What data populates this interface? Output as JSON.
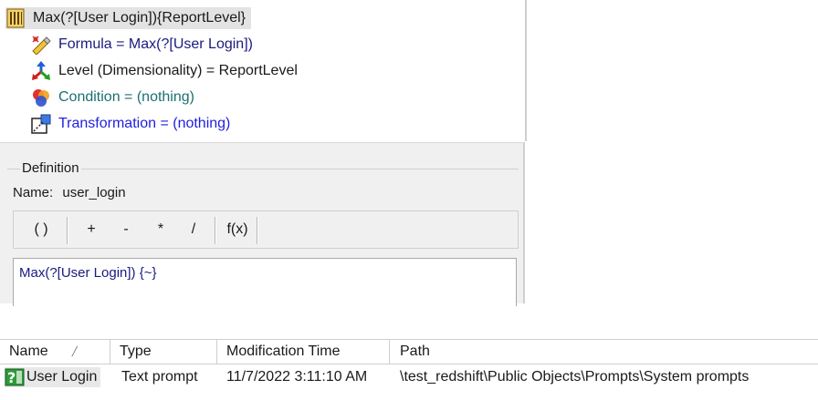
{
  "tree": {
    "root_label": "Max(?[User Login]){ReportLevel}",
    "items": [
      {
        "id": "formula",
        "label": "Formula = Max(?[User Login])",
        "icon": "formula-icon",
        "color": "#1a1a80"
      },
      {
        "id": "level",
        "label": "Level (Dimensionality) = ReportLevel",
        "icon": "level-icon",
        "color": "#1a1a1a"
      },
      {
        "id": "condition",
        "label": "Condition = (nothing)",
        "icon": "condition-icon",
        "color": "#1d6f73"
      },
      {
        "id": "transformation",
        "label": "Transformation = (nothing)",
        "icon": "transformation-icon",
        "color": "#1f1fe0"
      }
    ]
  },
  "definition": {
    "caption": "Definition",
    "name_label": "Name:",
    "name_value": "user_login",
    "toolbar": [
      "( )",
      "+",
      "-",
      "*",
      "/",
      "f(x)"
    ],
    "expression": "Max(?[User Login]) {~}"
  },
  "list": {
    "columns": [
      "Name",
      "Type",
      "Modification Time",
      "Path"
    ],
    "rows": [
      {
        "name": "User Login",
        "type": "Text prompt",
        "modified": "11/7/2022 3:11:10 AM",
        "path": "\\test_redshift\\Public Objects\\Prompts\\System prompts"
      }
    ]
  }
}
